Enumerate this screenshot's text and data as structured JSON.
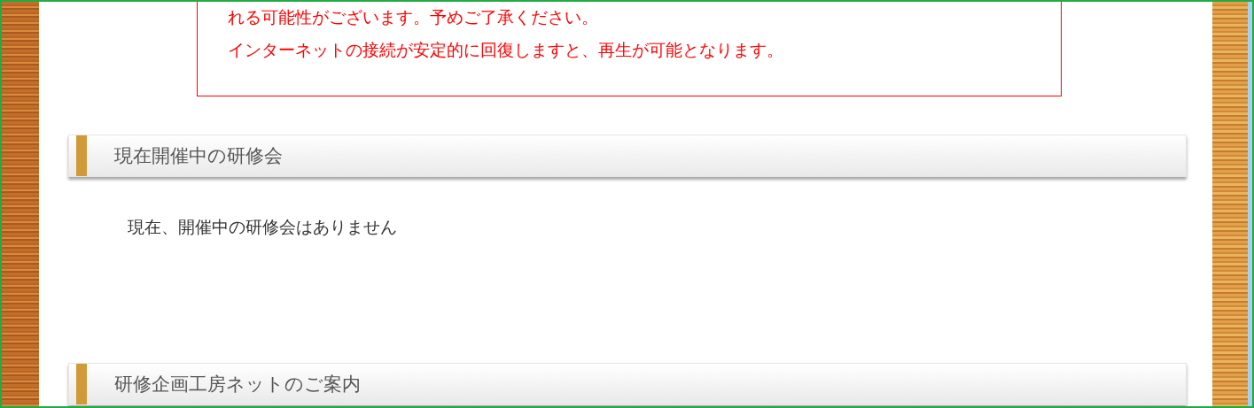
{
  "notice": {
    "lines": [
      "れる可能性がございます。予めご了承ください。",
      "インターネットの接続が安定的に回復しますと、再生が可能となります。"
    ]
  },
  "sections": [
    {
      "heading": "現在開催中の研修会",
      "body": "現在、開催中の研修会はありません"
    },
    {
      "heading": "研修企画工房ネットのご案内"
    }
  ]
}
